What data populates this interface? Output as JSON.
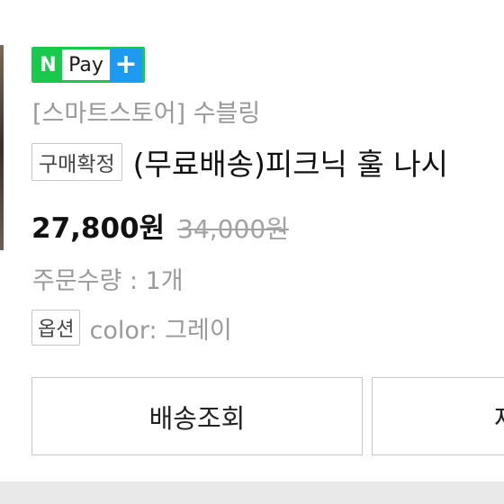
{
  "npay": {
    "n": "N",
    "label": "Pay",
    "plus": "+"
  },
  "order": {
    "store_name": "[스마트스토어] 수블링",
    "status_badge": "구매확정",
    "product_title": "(무료배송)피크닉 훌 나시",
    "price": "27,800원",
    "original_price": "34,000원",
    "quantity": "주문수량 : 1개",
    "option_badge": "옵션",
    "option_value": "color: 그레이"
  },
  "buttons": {
    "track_label": "배송조회",
    "second_label_partial": "재"
  },
  "colors": {
    "npay_green": "#19c94b",
    "npay_blue": "#1d9bf0"
  }
}
